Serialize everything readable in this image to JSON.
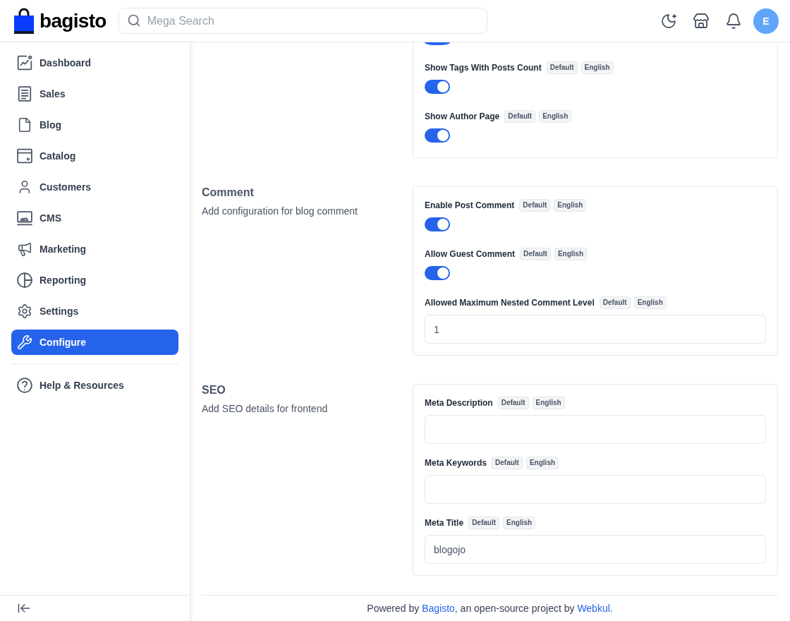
{
  "header": {
    "logo_text": "bagisto",
    "search": {
      "placeholder": "Mega Search"
    },
    "avatar": {
      "initial": "E"
    }
  },
  "sidebar": {
    "items": [
      {
        "label": "Dashboard",
        "selected": false
      },
      {
        "label": "Sales",
        "selected": false
      },
      {
        "label": "Blog",
        "selected": false
      },
      {
        "label": "Catalog",
        "selected": false
      },
      {
        "label": "Customers",
        "selected": false
      },
      {
        "label": "CMS",
        "selected": false
      },
      {
        "label": "Marketing",
        "selected": false
      },
      {
        "label": "Reporting",
        "selected": false
      },
      {
        "label": "Settings",
        "selected": false
      },
      {
        "label": "Configure",
        "selected": true
      }
    ],
    "help_items": [
      {
        "label": "Help & Resources",
        "selected": false
      }
    ]
  },
  "sections": [
    {
      "cut_off_top": true,
      "fields": [
        {
          "kind": "toggle_clipped",
          "on": true
        },
        {
          "kind": "toggle",
          "label": "Show Tags With Posts Count",
          "badges": [
            "Default",
            "English"
          ],
          "on": true
        },
        {
          "kind": "toggle",
          "label": "Show Author Page",
          "badges": [
            "Default",
            "English"
          ],
          "on": true
        }
      ]
    },
    {
      "cut_off_top": false,
      "title": "Comment",
      "description": "Add configuration for blog comment",
      "fields": [
        {
          "kind": "toggle",
          "label": "Enable Post Comment",
          "badges": [
            "Default",
            "English"
          ],
          "on": true
        },
        {
          "kind": "toggle",
          "label": "Allow Guest Comment",
          "badges": [
            "Default",
            "English"
          ],
          "on": true
        },
        {
          "kind": "input",
          "label": "Allowed Maximum Nested Comment Level",
          "badges": [
            "Default",
            "English"
          ],
          "value": "1"
        }
      ]
    },
    {
      "cut_off_top": false,
      "title": "SEO",
      "description": "Add SEO details for frontend",
      "fields": [
        {
          "kind": "input",
          "label": "Meta Description",
          "badges": [
            "Default",
            "English"
          ]
        },
        {
          "kind": "input",
          "label": "Meta Keywords",
          "badges": [
            "Default",
            "English"
          ]
        },
        {
          "kind": "input",
          "label": "Meta Title",
          "badges": [
            "Default",
            "English"
          ],
          "value": "blogojo"
        }
      ]
    }
  ],
  "footer": {
    "parts": [
      {
        "kind": "text",
        "text": "Powered by "
      },
      {
        "kind": "link",
        "text": "Bagisto"
      },
      {
        "kind": "text",
        "text": ", an open-source project by "
      },
      {
        "kind": "link",
        "text": "Webkul"
      },
      {
        "kind": "text",
        "text": "."
      }
    ]
  }
}
